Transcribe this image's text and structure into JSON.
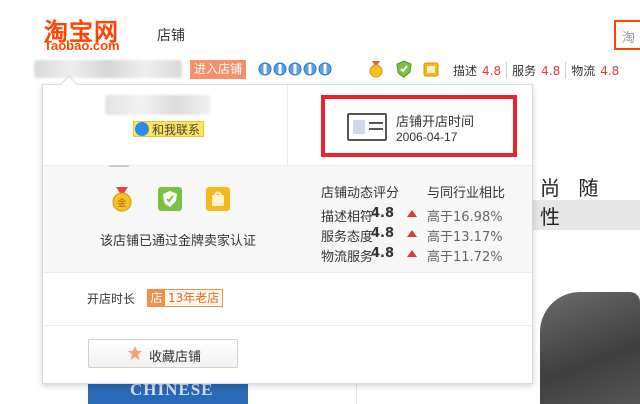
{
  "header": {
    "logo_cn": "淘宝网",
    "logo_en": "Taobao.com",
    "nav_shop": "店铺",
    "search_stub": "淘"
  },
  "shopbar": {
    "enter_shop": "进入店铺",
    "crown_count": 5,
    "ratings": [
      {
        "label": "描述",
        "value": "4.8"
      },
      {
        "label": "服务",
        "value": "4.8"
      },
      {
        "label": "物流",
        "value": "4.8"
      }
    ]
  },
  "popup": {
    "contact_label": "和我联系",
    "open_time_title": "店铺开店时间",
    "open_time_date": "2006-04-17",
    "cert_text": "该店铺已通过金牌卖家认证",
    "score_header": "店铺动态评分",
    "compare_header": "与同行业相比",
    "scores": [
      {
        "name": "描述相符",
        "value": "4.8",
        "compare": "高于16.98%"
      },
      {
        "name": "服务态度",
        "value": "4.8",
        "compare": "高于13.17%"
      },
      {
        "name": "物流服务",
        "value": "4.8",
        "compare": "高于11.72%"
      }
    ],
    "age_label": "开店时长",
    "age_badge_icon": "店",
    "age_badge_text": "13年老店",
    "favorite_label": "收藏店铺"
  },
  "background": {
    "slogan": "尚 随 性",
    "product_text": "CHINESE"
  },
  "colors": {
    "brand": "#ff4400",
    "highlight_border": "#e8242b",
    "score_red": "#e4393c",
    "badge_orange": "#f19149"
  }
}
